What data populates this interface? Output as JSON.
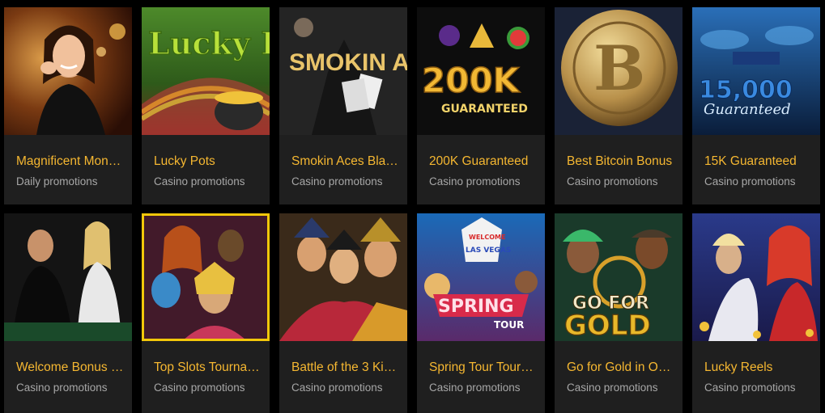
{
  "cards": [
    {
      "title": "Magnificent Mon…",
      "subtitle": "Daily promotions",
      "thumb_text": ""
    },
    {
      "title": "Lucky Pots",
      "subtitle": "Casino promotions",
      "thumb_text": "Lucky Pots"
    },
    {
      "title": "Smokin Aces Bla…",
      "subtitle": "Casino promotions",
      "thumb_text": "SMOKIN ACES"
    },
    {
      "title": "200K Guaranteed",
      "subtitle": "Casino promotions",
      "thumb_text": "200K",
      "thumb_sub": "GUARANTEED"
    },
    {
      "title": "Best Bitcoin Bonus",
      "subtitle": "Casino promotions",
      "thumb_text": "B"
    },
    {
      "title": "15K Guaranteed",
      "subtitle": "Casino promotions",
      "thumb_text": "15,000",
      "thumb_sub": "Guaranteed"
    },
    {
      "title": "Welcome Bonus …",
      "subtitle": "Casino promotions",
      "thumb_text": ""
    },
    {
      "title": "Top Slots Tourna…",
      "subtitle": "Casino promotions",
      "thumb_text": ""
    },
    {
      "title": "Battle of the 3 Ki…",
      "subtitle": "Casino promotions",
      "thumb_text": ""
    },
    {
      "title": "Spring Tour Tour…",
      "subtitle": "Casino promotions",
      "thumb_text": "SPRING",
      "thumb_sub": "TOUR",
      "thumb_top": "WELCOME",
      "thumb_top2": "LAS VEGAS"
    },
    {
      "title": "Go for Gold in O…",
      "subtitle": "Casino promotions",
      "thumb_text": "GO FOR",
      "thumb_sub": "GOLD"
    },
    {
      "title": "Lucky Reels",
      "subtitle": "Casino promotions",
      "thumb_text": ""
    }
  ],
  "colors": {
    "title": "#f5b731",
    "subtitle": "#a7a7a7",
    "card_bg": "#1f1f1f",
    "page_bg": "#000000"
  }
}
